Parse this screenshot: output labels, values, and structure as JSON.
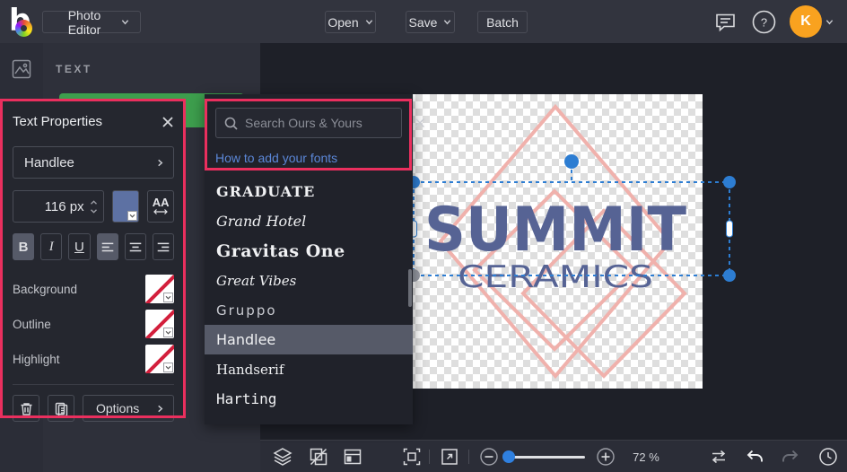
{
  "colors": {
    "annotation_pink": "#ea2f5e",
    "accent_green": "#3d9e4d",
    "selection_blue": "#2d7dd2",
    "text_color_swatch": "#5d71a3",
    "logo_text_blue": "#566394",
    "diamond_salmon": "#f0b1ac",
    "avatar_orange": "#f9a21f",
    "link_blue": "#5b87d7"
  },
  "top_bar": {
    "logo_letter": "b",
    "app_menu_label": "Photo Editor",
    "open_label": "Open",
    "save_label": "Save",
    "batch_label": "Batch",
    "help_glyph": "?",
    "avatar_initial": "K",
    "icons": [
      "befunky-logo",
      "comment-icon",
      "help-icon",
      "avatar"
    ]
  },
  "left_nav": {
    "icons": [
      "image-manager-icon"
    ]
  },
  "text_panel": {
    "header": "TEXT"
  },
  "text_properties": {
    "title": "Text Properties",
    "font_name": "Handlee",
    "font_size_value": "116 px",
    "bold_label": "B",
    "italic_label": "I",
    "underline_label": "U",
    "letter_spacing_label": "AA",
    "background_label": "Background",
    "outline_label": "Outline",
    "highlight_label": "Highlight",
    "options_label": "Options",
    "active_buttons": [
      "bold",
      "align-left"
    ],
    "icons": [
      "close-icon",
      "chevron-right-icon",
      "trash-icon",
      "copy-icon",
      "align-left-icon",
      "align-center-icon",
      "align-right-icon"
    ]
  },
  "fonts_panel": {
    "search_placeholder": "Search Ours & Yours",
    "link_label": "How to add your fonts",
    "selected_font": "Handlee",
    "items": [
      {
        "label": "Graduate"
      },
      {
        "label": "Grand Hotel"
      },
      {
        "label": "Gravitas One"
      },
      {
        "label": "Great Vibes"
      },
      {
        "label": "Gruppo"
      },
      {
        "label": "Handlee"
      },
      {
        "label": "Handserif"
      },
      {
        "label": "Harting"
      }
    ]
  },
  "canvas": {
    "text_line1": "SUMMIT",
    "text_line2": "CERAMICS",
    "background": "transparent-checkerboard",
    "selected_object": "text-layer"
  },
  "bottom_toolbar": {
    "zoom_level": "72 %",
    "icons": [
      "layers-icon",
      "crop-rotate-icon",
      "layout-icon",
      "fit-screen-icon",
      "resize-icon",
      "zoom-out-icon",
      "zoom-slider",
      "zoom-in-icon",
      "compare-icon",
      "undo-icon",
      "redo-icon",
      "history-icon"
    ]
  }
}
